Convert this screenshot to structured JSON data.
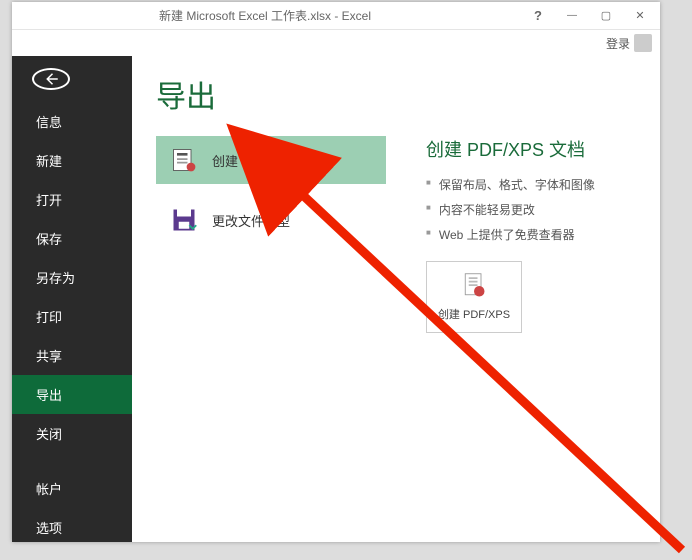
{
  "titlebar": {
    "title": "新建 Microsoft Excel 工作表.xlsx - Excel",
    "signin": "登录"
  },
  "sidebar": {
    "items": [
      {
        "label": "信息"
      },
      {
        "label": "新建"
      },
      {
        "label": "打开"
      },
      {
        "label": "保存"
      },
      {
        "label": "另存为"
      },
      {
        "label": "打印"
      },
      {
        "label": "共享"
      },
      {
        "label": "导出"
      },
      {
        "label": "关闭"
      }
    ],
    "footer": [
      {
        "label": "帐户"
      },
      {
        "label": "选项"
      }
    ]
  },
  "page": {
    "title": "导出",
    "options": {
      "pdf": "创建 PDF/XPS 文档",
      "change": "更改文件类型"
    },
    "detail": {
      "heading": "创建 PDF/XPS 文档",
      "bullets": [
        "保留布局、格式、字体和图像",
        "内容不能轻易更改",
        "Web 上提供了免费查看器"
      ],
      "action": "创建 PDF/XPS"
    }
  }
}
